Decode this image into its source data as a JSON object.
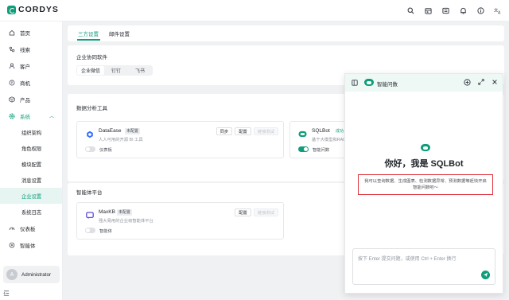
{
  "brand": {
    "name": "CORDYS",
    "accent": "#0f9d7a"
  },
  "topbar": {
    "icons": [
      "search-icon",
      "calendar-icon",
      "mail-icon",
      "bell-icon",
      "info-icon",
      "translate-icon"
    ]
  },
  "sidebar": {
    "items": [
      {
        "label": "首页",
        "icon": "home-icon"
      },
      {
        "label": "线索",
        "icon": "leads-icon"
      },
      {
        "label": "客户",
        "icon": "customer-icon"
      },
      {
        "label": "商机",
        "icon": "opportunity-icon"
      },
      {
        "label": "产品",
        "icon": "product-icon"
      },
      {
        "label": "系统",
        "icon": "system-icon"
      }
    ],
    "sub_items": [
      "组织架构",
      "角色权限",
      "模块配置",
      "消息设置",
      "企业设置",
      "系统日志"
    ],
    "bottom_items": [
      {
        "label": "仪表板",
        "icon": "dashboard-icon"
      },
      {
        "label": "智能体",
        "icon": "agent-icon"
      }
    ],
    "user": {
      "initial": "A",
      "name": "Administrator"
    }
  },
  "tabs": [
    "三方设置",
    "邮件设置"
  ],
  "collab": {
    "title": "企业协同软件",
    "options": [
      "企业微信",
      "钉钉",
      "飞书"
    ]
  },
  "analysis": {
    "title": "数据分析工具",
    "tools": [
      {
        "name": "DataEase",
        "badge": "未配置",
        "desc": "人人可用的开源 BI 工具",
        "buttons": [
          "同步",
          "配置",
          "链接测试"
        ],
        "toggle_label": "仪表板"
      },
      {
        "name": "SQLBot",
        "badge": "成功",
        "desc": "基于大模型和RAG",
        "toggle_label": "智能问数"
      }
    ]
  },
  "agents": {
    "title": "智能体平台",
    "tools": [
      {
        "name": "MaxKB",
        "badge": "未配置",
        "desc": "强大易用的企业级智能体平台",
        "buttons": [
          "配置",
          "链接测试"
        ],
        "toggle_label": "智能体"
      }
    ]
  },
  "chat": {
    "title": "智能问数",
    "greeting": "你好，我是 SQLBot",
    "intro": "我可以查询数据、生成图表、检测数据异常、预测数据等赶快开启智能问数吧～",
    "input_placeholder": "按下 Enter 提交问题，或使用 Ctrl + Enter 换行"
  }
}
